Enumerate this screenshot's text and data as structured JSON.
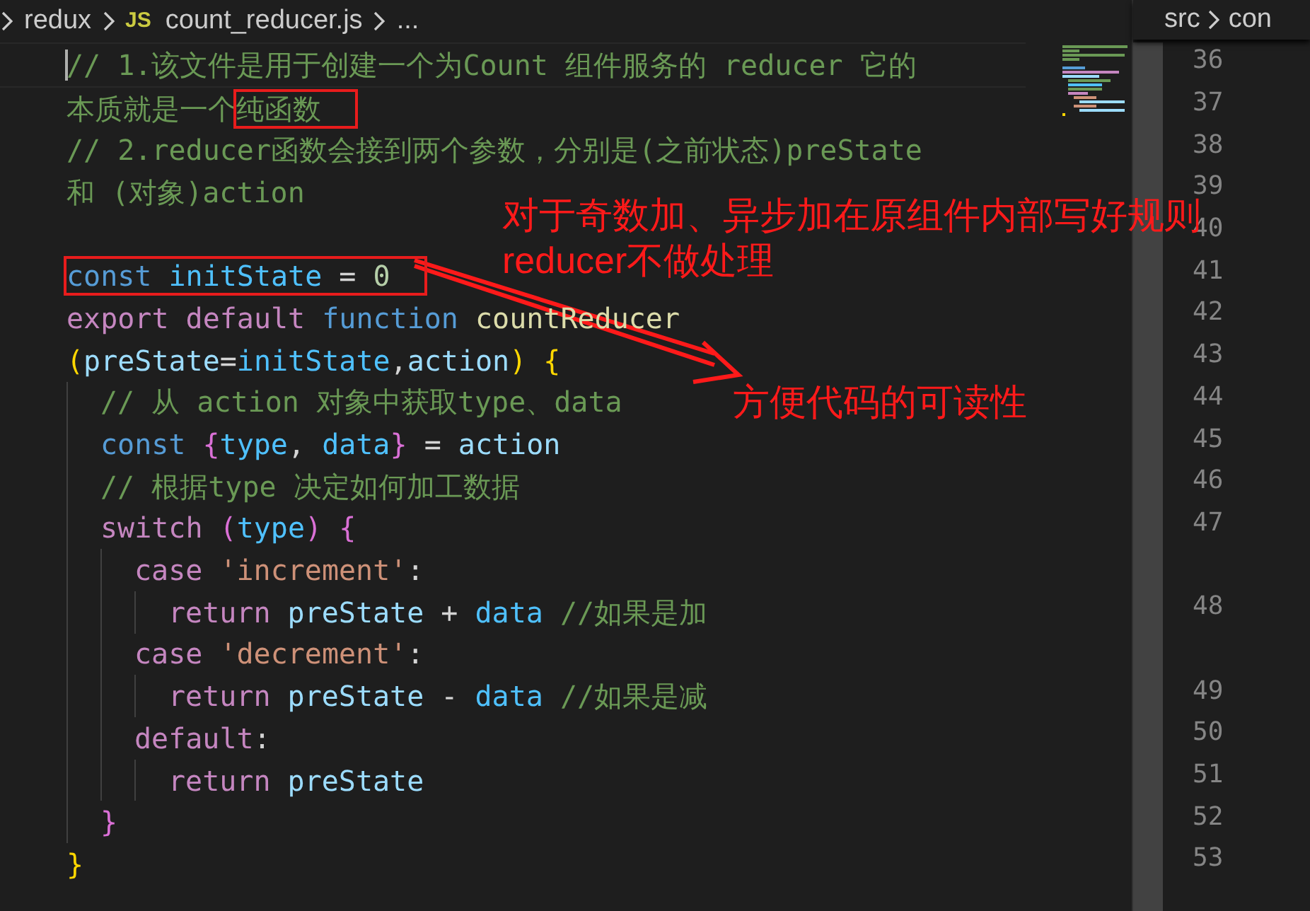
{
  "breadcrumb": {
    "items": [
      {
        "text": "redux",
        "icon": false
      },
      {
        "text": "count_reducer.js",
        "icon": true,
        "icon_label": "JS"
      }
    ],
    "more": "..."
  },
  "editor": {
    "lines": [
      {
        "kind": "code",
        "rows": [
          [
            {
              "boxed": false,
              "tokens": [
                {
                  "kind": "comment",
                  "text": "// 1.该文件是用于创建一个为Count 组件服务的 reducer 它的"
                }
              ]
            }
          ],
          [
            {
              "boxed": false,
              "tokens": [
                {
                  "kind": "comment",
                  "text": "本质就是一个"
                }
              ]
            },
            {
              "boxed": true,
              "tokens": [
                {
                  "kind": "comment",
                  "text": "纯函数"
                }
              ]
            }
          ]
        ]
      },
      {
        "kind": "code",
        "rows": [
          [
            {
              "boxed": false,
              "tokens": [
                {
                  "kind": "comment",
                  "text": "// 2.reducer函数会接到两个参数，分别是(之前状态)preState"
                }
              ]
            }
          ],
          [
            {
              "boxed": false,
              "tokens": [
                {
                  "kind": "comment",
                  "text": "和 (对象)action"
                }
              ]
            }
          ]
        ]
      },
      {
        "kind": "blank"
      },
      {
        "kind": "code",
        "rows": [
          [
            {
              "boxed": true,
              "tokens": [
                {
                  "kind": "storage",
                  "text": "const "
                },
                {
                  "kind": "constant",
                  "text": "initState"
                },
                {
                  "kind": "plain",
                  "text": " = "
                },
                {
                  "kind": "number",
                  "text": "0"
                }
              ]
            }
          ]
        ]
      },
      {
        "kind": "code",
        "rows": [
          [
            {
              "boxed": false,
              "tokens": [
                {
                  "kind": "keyword",
                  "text": "export default "
                },
                {
                  "kind": "storage",
                  "text": "function "
                },
                {
                  "kind": "function",
                  "text": "countReducer"
                }
              ]
            }
          ],
          [
            {
              "boxed": false,
              "tokens": [
                {
                  "kind": "bracket1",
                  "text": "("
                },
                {
                  "kind": "variable",
                  "text": "preState"
                },
                {
                  "kind": "plain",
                  "text": "="
                },
                {
                  "kind": "constant",
                  "text": "initState"
                },
                {
                  "kind": "plain",
                  "text": ","
                },
                {
                  "kind": "variable",
                  "text": "action"
                },
                {
                  "kind": "bracket1",
                  "text": ") {"
                }
              ]
            }
          ]
        ]
      },
      {
        "kind": "code",
        "rows": [
          [
            {
              "boxed": false,
              "tokens": [
                {
                  "kind": "comment",
                  "text": "  // 从 action 对象中获取type、data"
                }
              ]
            }
          ]
        ]
      },
      {
        "kind": "code",
        "rows": [
          [
            {
              "boxed": false,
              "tokens": [
                {
                  "kind": "storage",
                  "text": "  const "
                },
                {
                  "kind": "bracket2",
                  "text": "{"
                },
                {
                  "kind": "constant",
                  "text": "type"
                },
                {
                  "kind": "plain",
                  "text": ", "
                },
                {
                  "kind": "constant",
                  "text": "data"
                },
                {
                  "kind": "bracket2",
                  "text": "}"
                },
                {
                  "kind": "plain",
                  "text": " = "
                },
                {
                  "kind": "variable",
                  "text": "action"
                }
              ]
            }
          ]
        ]
      },
      {
        "kind": "code",
        "rows": [
          [
            {
              "boxed": false,
              "tokens": [
                {
                  "kind": "comment",
                  "text": "  // 根据type 决定如何加工数据"
                }
              ]
            }
          ]
        ]
      },
      {
        "kind": "code",
        "rows": [
          [
            {
              "boxed": false,
              "tokens": [
                {
                  "kind": "keyword",
                  "text": "  switch "
                },
                {
                  "kind": "bracket2",
                  "text": "("
                },
                {
                  "kind": "constant",
                  "text": "type"
                },
                {
                  "kind": "bracket2",
                  "text": ") {"
                }
              ]
            }
          ]
        ]
      },
      {
        "kind": "code",
        "rows": [
          [
            {
              "boxed": false,
              "tokens": [
                {
                  "kind": "keyword",
                  "text": "    case "
                },
                {
                  "kind": "string",
                  "text": "'increment'"
                },
                {
                  "kind": "plain",
                  "text": ":"
                }
              ]
            }
          ]
        ]
      },
      {
        "kind": "code",
        "rows": [
          [
            {
              "boxed": false,
              "tokens": [
                {
                  "kind": "keyword",
                  "text": "      return "
                },
                {
                  "kind": "variable",
                  "text": "preState"
                },
                {
                  "kind": "plain",
                  "text": " + "
                },
                {
                  "kind": "constant",
                  "text": "data"
                },
                {
                  "kind": "comment",
                  "text": " //如果是加"
                }
              ]
            }
          ]
        ]
      },
      {
        "kind": "code",
        "rows": [
          [
            {
              "boxed": false,
              "tokens": [
                {
                  "kind": "keyword",
                  "text": "    case "
                },
                {
                  "kind": "string",
                  "text": "'decrement'"
                },
                {
                  "kind": "plain",
                  "text": ":"
                }
              ]
            }
          ]
        ]
      },
      {
        "kind": "code",
        "rows": [
          [
            {
              "boxed": false,
              "tokens": [
                {
                  "kind": "keyword",
                  "text": "      return "
                },
                {
                  "kind": "variable",
                  "text": "preState"
                },
                {
                  "kind": "plain",
                  "text": " - "
                },
                {
                  "kind": "constant",
                  "text": "data"
                },
                {
                  "kind": "comment",
                  "text": " //如果是减"
                }
              ]
            }
          ]
        ]
      },
      {
        "kind": "code",
        "rows": [
          [
            {
              "boxed": false,
              "tokens": [
                {
                  "kind": "keyword",
                  "text": "    default"
                },
                {
                  "kind": "plain",
                  "text": ":"
                }
              ]
            }
          ]
        ]
      },
      {
        "kind": "code",
        "rows": [
          [
            {
              "boxed": false,
              "tokens": [
                {
                  "kind": "keyword",
                  "text": "      return "
                },
                {
                  "kind": "variable",
                  "text": "preState"
                }
              ]
            }
          ]
        ]
      },
      {
        "kind": "code",
        "rows": [
          [
            {
              "boxed": false,
              "tokens": [
                {
                  "kind": "bracket2",
                  "text": "  }"
                }
              ]
            }
          ]
        ]
      },
      {
        "kind": "code",
        "rows": [
          [
            {
              "boxed": false,
              "tokens": [
                {
                  "kind": "bracket1",
                  "text": "}"
                }
              ]
            }
          ]
        ]
      }
    ]
  },
  "right_pane": {
    "breadcrumb": {
      "folder": "src",
      "partial": "con"
    },
    "numbers": [
      {
        "number": "36",
        "wrapped": false
      },
      {
        "number": "37",
        "wrapped": false
      },
      {
        "number": "38",
        "wrapped": false
      },
      {
        "number": "39",
        "wrapped": false
      },
      {
        "number": "40",
        "wrapped": false
      },
      {
        "number": "41",
        "wrapped": false
      },
      {
        "number": "42",
        "wrapped": false
      },
      {
        "number": "43",
        "wrapped": false
      },
      {
        "number": "44",
        "wrapped": false
      },
      {
        "number": "45",
        "wrapped": false
      },
      {
        "number": "46",
        "wrapped": false
      },
      {
        "number": "47",
        "wrapped": true
      },
      {
        "number": "48",
        "wrapped": true
      },
      {
        "number": "49",
        "wrapped": false
      },
      {
        "number": "50",
        "wrapped": false
      },
      {
        "number": "51",
        "wrapped": false
      },
      {
        "number": "52",
        "wrapped": false
      },
      {
        "number": "53",
        "wrapped": false
      }
    ]
  },
  "annotations": [
    {
      "lines": [
        "对于奇数加、异步加在原组件内部写好规则",
        "reducer不做处理"
      ]
    },
    {
      "lines": [
        "方便代码的可读性"
      ]
    }
  ]
}
